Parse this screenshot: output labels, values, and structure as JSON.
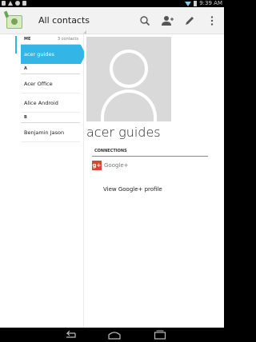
{
  "status_bar": {
    "time": "9:39 AM"
  },
  "app": {
    "title": "All contacts"
  },
  "list": {
    "me_header": "ME",
    "me_count": "3 contacts",
    "me_contact": "acer guides",
    "sections": [
      {
        "letter": "A",
        "contacts": [
          "Acer Office",
          "Alice Android"
        ]
      },
      {
        "letter": "B",
        "contacts": [
          "Benjamin Jason"
        ]
      }
    ]
  },
  "detail": {
    "name": "acer guides",
    "connections_header": "CONNECTIONS",
    "gplus_label": "Google+",
    "gplus_icon_text": "g+",
    "view_profile": "View Google+ profile"
  },
  "colors": {
    "accent": "#33b5e5",
    "gplus": "#d34836"
  }
}
